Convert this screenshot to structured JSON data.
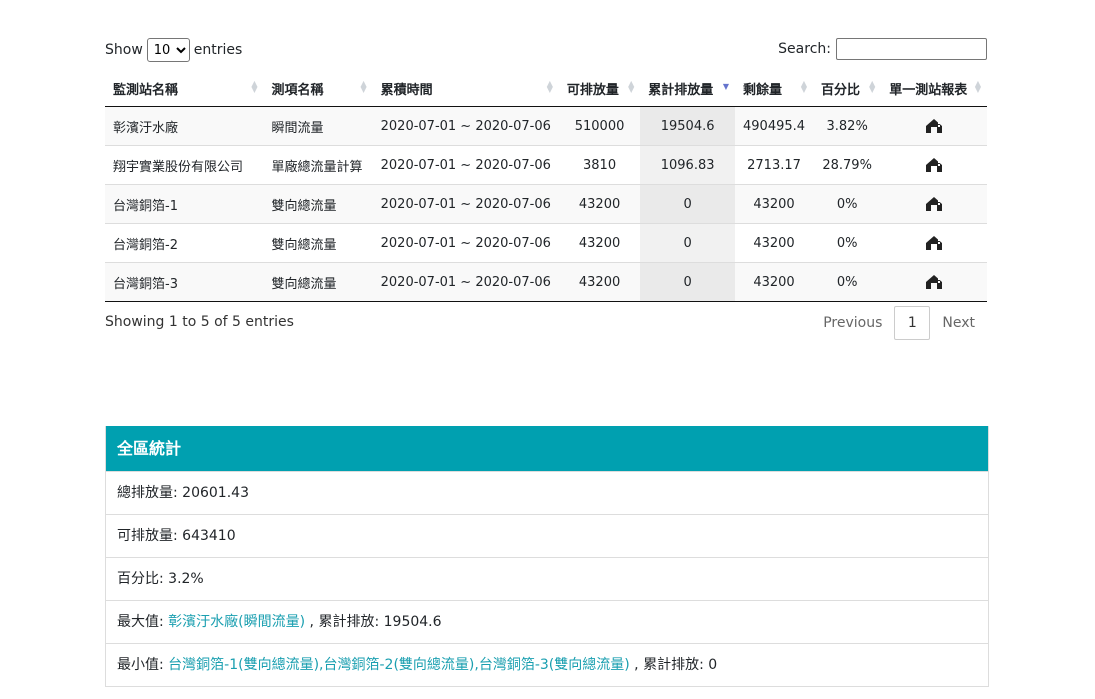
{
  "controls": {
    "show_label": "Show",
    "entries_label": "entries",
    "page_length_value": "10",
    "search_label": "Search:",
    "search_value": ""
  },
  "table": {
    "headers": [
      "監測站名稱",
      "測項名稱",
      "累積時間",
      "可排放量",
      "累計排放量",
      "剩餘量",
      "百分比",
      "單一測站報表"
    ],
    "rows": [
      {
        "station": "彰濱汙水廠",
        "item": "瞬間流量",
        "period": "2020-07-01 ~ 2020-07-06",
        "allowed": "510000",
        "cumulative": "19504.6",
        "remaining": "490495.4",
        "percent": "3.82%",
        "report_icon": "report-house-icon"
      },
      {
        "station": "翔宇實業股份有限公司",
        "item": "單廠總流量計算",
        "period": "2020-07-01 ~ 2020-07-06",
        "allowed": "3810",
        "cumulative": "1096.83",
        "remaining": "2713.17",
        "percent": "28.79%",
        "report_icon": "report-house-icon"
      },
      {
        "station": "台灣銅箔-1",
        "item": "雙向總流量",
        "period": "2020-07-01 ~ 2020-07-06",
        "allowed": "43200",
        "cumulative": "0",
        "remaining": "43200",
        "percent": "0%",
        "report_icon": "report-house-icon"
      },
      {
        "station": "台灣銅箔-2",
        "item": "雙向總流量",
        "period": "2020-07-01 ~ 2020-07-06",
        "allowed": "43200",
        "cumulative": "0",
        "remaining": "43200",
        "percent": "0%",
        "report_icon": "report-house-icon"
      },
      {
        "station": "台灣銅箔-3",
        "item": "雙向總流量",
        "period": "2020-07-01 ~ 2020-07-06",
        "allowed": "43200",
        "cumulative": "0",
        "remaining": "43200",
        "percent": "0%",
        "report_icon": "report-house-icon"
      }
    ]
  },
  "footer": {
    "info": "Showing 1 to 5 of 5 entries",
    "previous": "Previous",
    "page": "1",
    "next": "Next"
  },
  "stats": {
    "title": "全區統計",
    "total_label": "總排放量: ",
    "total_value": "20601.43",
    "allowed_label": "可排放量: ",
    "allowed_value": "643410",
    "percent_label": "百分比: ",
    "percent_value": "3.2%",
    "max_label": "最大值: ",
    "max_link": "彰濱汙水廠(瞬間流量)",
    "max_suffix": " , 累計排放: 19504.6",
    "min_label": "最小值: ",
    "min_link": "台灣銅箔-1(雙向總流量),台灣銅箔-2(雙向總流量),台灣銅箔-3(雙向總流量)",
    "min_suffix": " , 累計排放: 0"
  },
  "colors": {
    "panel_header": "#00a0b0",
    "link": "#1a9fb0",
    "sort_active": "#6574cd"
  }
}
